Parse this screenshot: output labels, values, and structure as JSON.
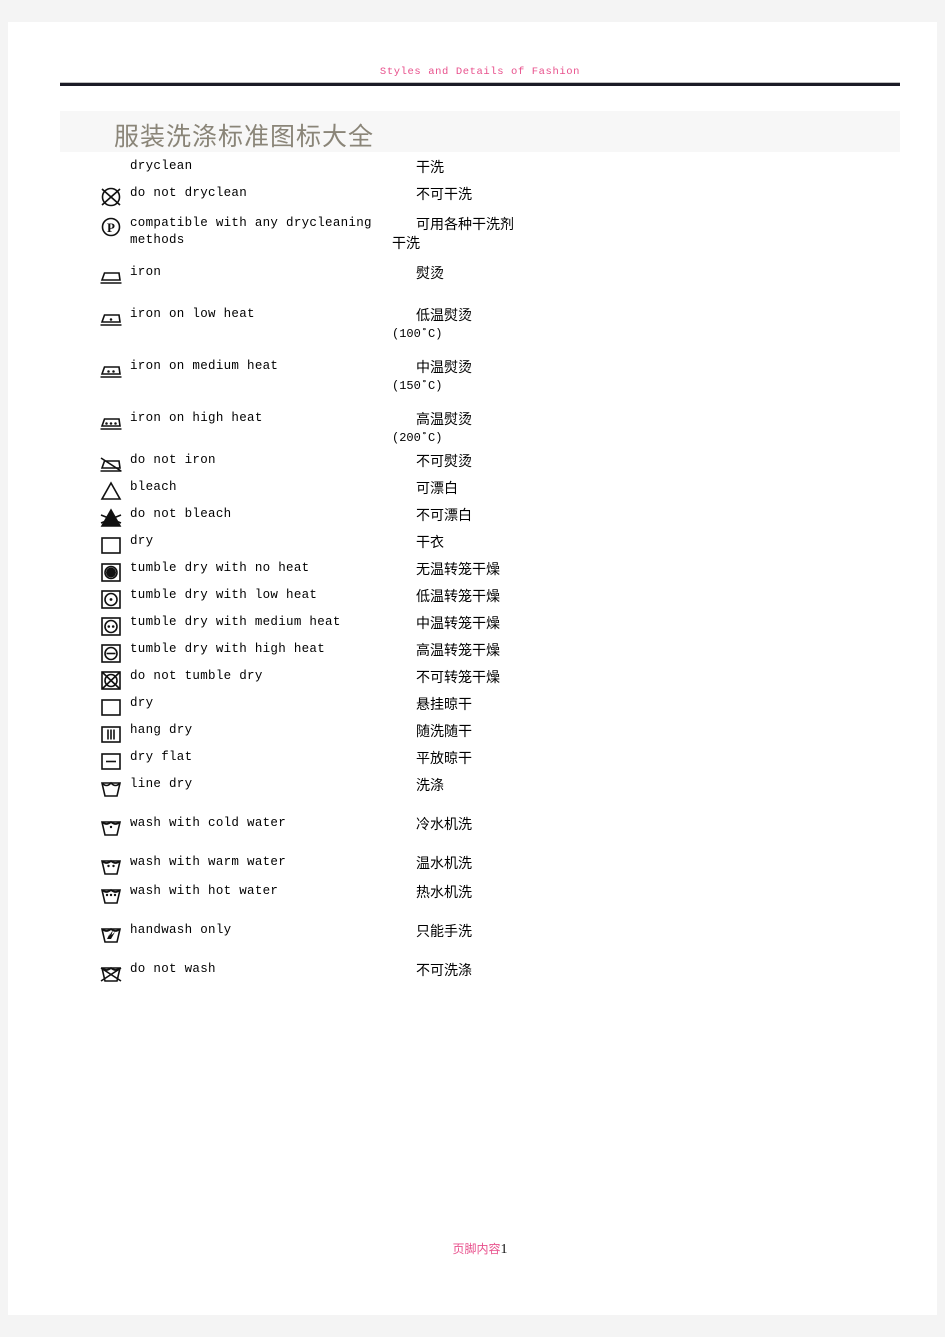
{
  "header": {
    "running_head": "Styles and Details of Fashion",
    "head_color": "#e8508c"
  },
  "title": {
    "text": "服装洗涤标准图标大全",
    "color": "#8a8578",
    "band_color": "#f7f7f7"
  },
  "footer": {
    "label": "页脚内容",
    "page_number": "1",
    "label_color": "#e8508c"
  },
  "rows": [
    {
      "icon": "none",
      "en": "dryclean",
      "zh": "干洗",
      "zh_cont": "",
      "temp": ""
    },
    {
      "icon": "do-not-dryclean-icon",
      "en": "do not dryclean",
      "zh": "不可干洗",
      "zh_cont": "",
      "temp": ""
    },
    {
      "icon": "dryclean-any-solvent-icon",
      "en": "compatible with any drycleaning methods",
      "zh": "可用各种干洗剂",
      "zh_cont": "干洗",
      "temp": ""
    },
    {
      "icon": "iron-icon",
      "en": "iron",
      "zh": "熨烫",
      "zh_cont": "",
      "temp": ""
    },
    {
      "icon": "iron-low-icon",
      "en": "iron on low heat",
      "zh": "低温熨烫",
      "zh_cont": "",
      "temp": "(100˚C)"
    },
    {
      "icon": "iron-medium-icon",
      "en": "iron on medium heat",
      "zh": "中温熨烫",
      "zh_cont": "",
      "temp": "(150˚C)"
    },
    {
      "icon": "iron-high-icon",
      "en": "iron on high heat",
      "zh": "高温熨烫",
      "zh_cont": "",
      "temp": "(200˚C)"
    },
    {
      "icon": "do-not-iron-icon",
      "en": "do not iron",
      "zh": "不可熨烫",
      "zh_cont": "",
      "temp": ""
    },
    {
      "icon": "bleach-icon",
      "en": "bleach",
      "zh": "可漂白",
      "zh_cont": "",
      "temp": ""
    },
    {
      "icon": "do-not-bleach-icon",
      "en": "do not bleach",
      "zh": "不可漂白",
      "zh_cont": "",
      "temp": ""
    },
    {
      "icon": "dry-square-icon",
      "en": "dry",
      "zh": "干衣",
      "zh_cont": "",
      "temp": ""
    },
    {
      "icon": "tumble-dry-no-heat-icon",
      "en": "tumble dry with no heat",
      "zh": "无温转笼干燥",
      "zh_cont": "",
      "temp": ""
    },
    {
      "icon": "tumble-dry-low-heat-icon",
      "en": "tumble dry with low heat",
      "zh": "低温转笼干燥",
      "zh_cont": "",
      "temp": ""
    },
    {
      "icon": "tumble-dry-medium-heat-icon",
      "en": "tumble dry with medium heat",
      "zh": "中温转笼干燥",
      "zh_cont": "",
      "temp": ""
    },
    {
      "icon": "tumble-dry-high-heat-icon",
      "en": "tumble dry with high heat",
      "zh": "高温转笼干燥",
      "zh_cont": "",
      "temp": ""
    },
    {
      "icon": "do-not-tumble-dry-icon",
      "en": "do not tumble dry",
      "zh": "不可转笼干燥",
      "zh_cont": "",
      "temp": ""
    },
    {
      "icon": "dry-square-icon",
      "en": "dry",
      "zh": "悬挂晾干",
      "zh_cont": "",
      "temp": ""
    },
    {
      "icon": "hang-dry-icon",
      "en": "hang dry",
      "zh": "随洗随干",
      "zh_cont": "",
      "temp": ""
    },
    {
      "icon": "dry-flat-icon",
      "en": "dry flat",
      "zh": "平放晾干",
      "zh_cont": "",
      "temp": ""
    },
    {
      "icon": "line-dry-icon",
      "en": "line dry",
      "zh": "洗涤",
      "zh_cont": "",
      "temp": ""
    },
    {
      "icon": "wash-cold-icon",
      "en": "wash with cold water",
      "zh": "冷水机洗",
      "zh_cont": "",
      "temp": ""
    },
    {
      "icon": "wash-warm-icon",
      "en": "wash with warm water",
      "zh": "温水机洗",
      "zh_cont": "",
      "temp": ""
    },
    {
      "icon": "wash-hot-icon",
      "en": "wash with hot water",
      "zh": "热水机洗",
      "zh_cont": "",
      "temp": ""
    },
    {
      "icon": "handwash-only-icon",
      "en": "handwash only",
      "zh": "只能手洗",
      "zh_cont": "",
      "temp": ""
    },
    {
      "icon": "do-not-wash-icon",
      "en": "do not wash",
      "zh": "不可洗涤",
      "zh_cont": "",
      "temp": ""
    }
  ]
}
